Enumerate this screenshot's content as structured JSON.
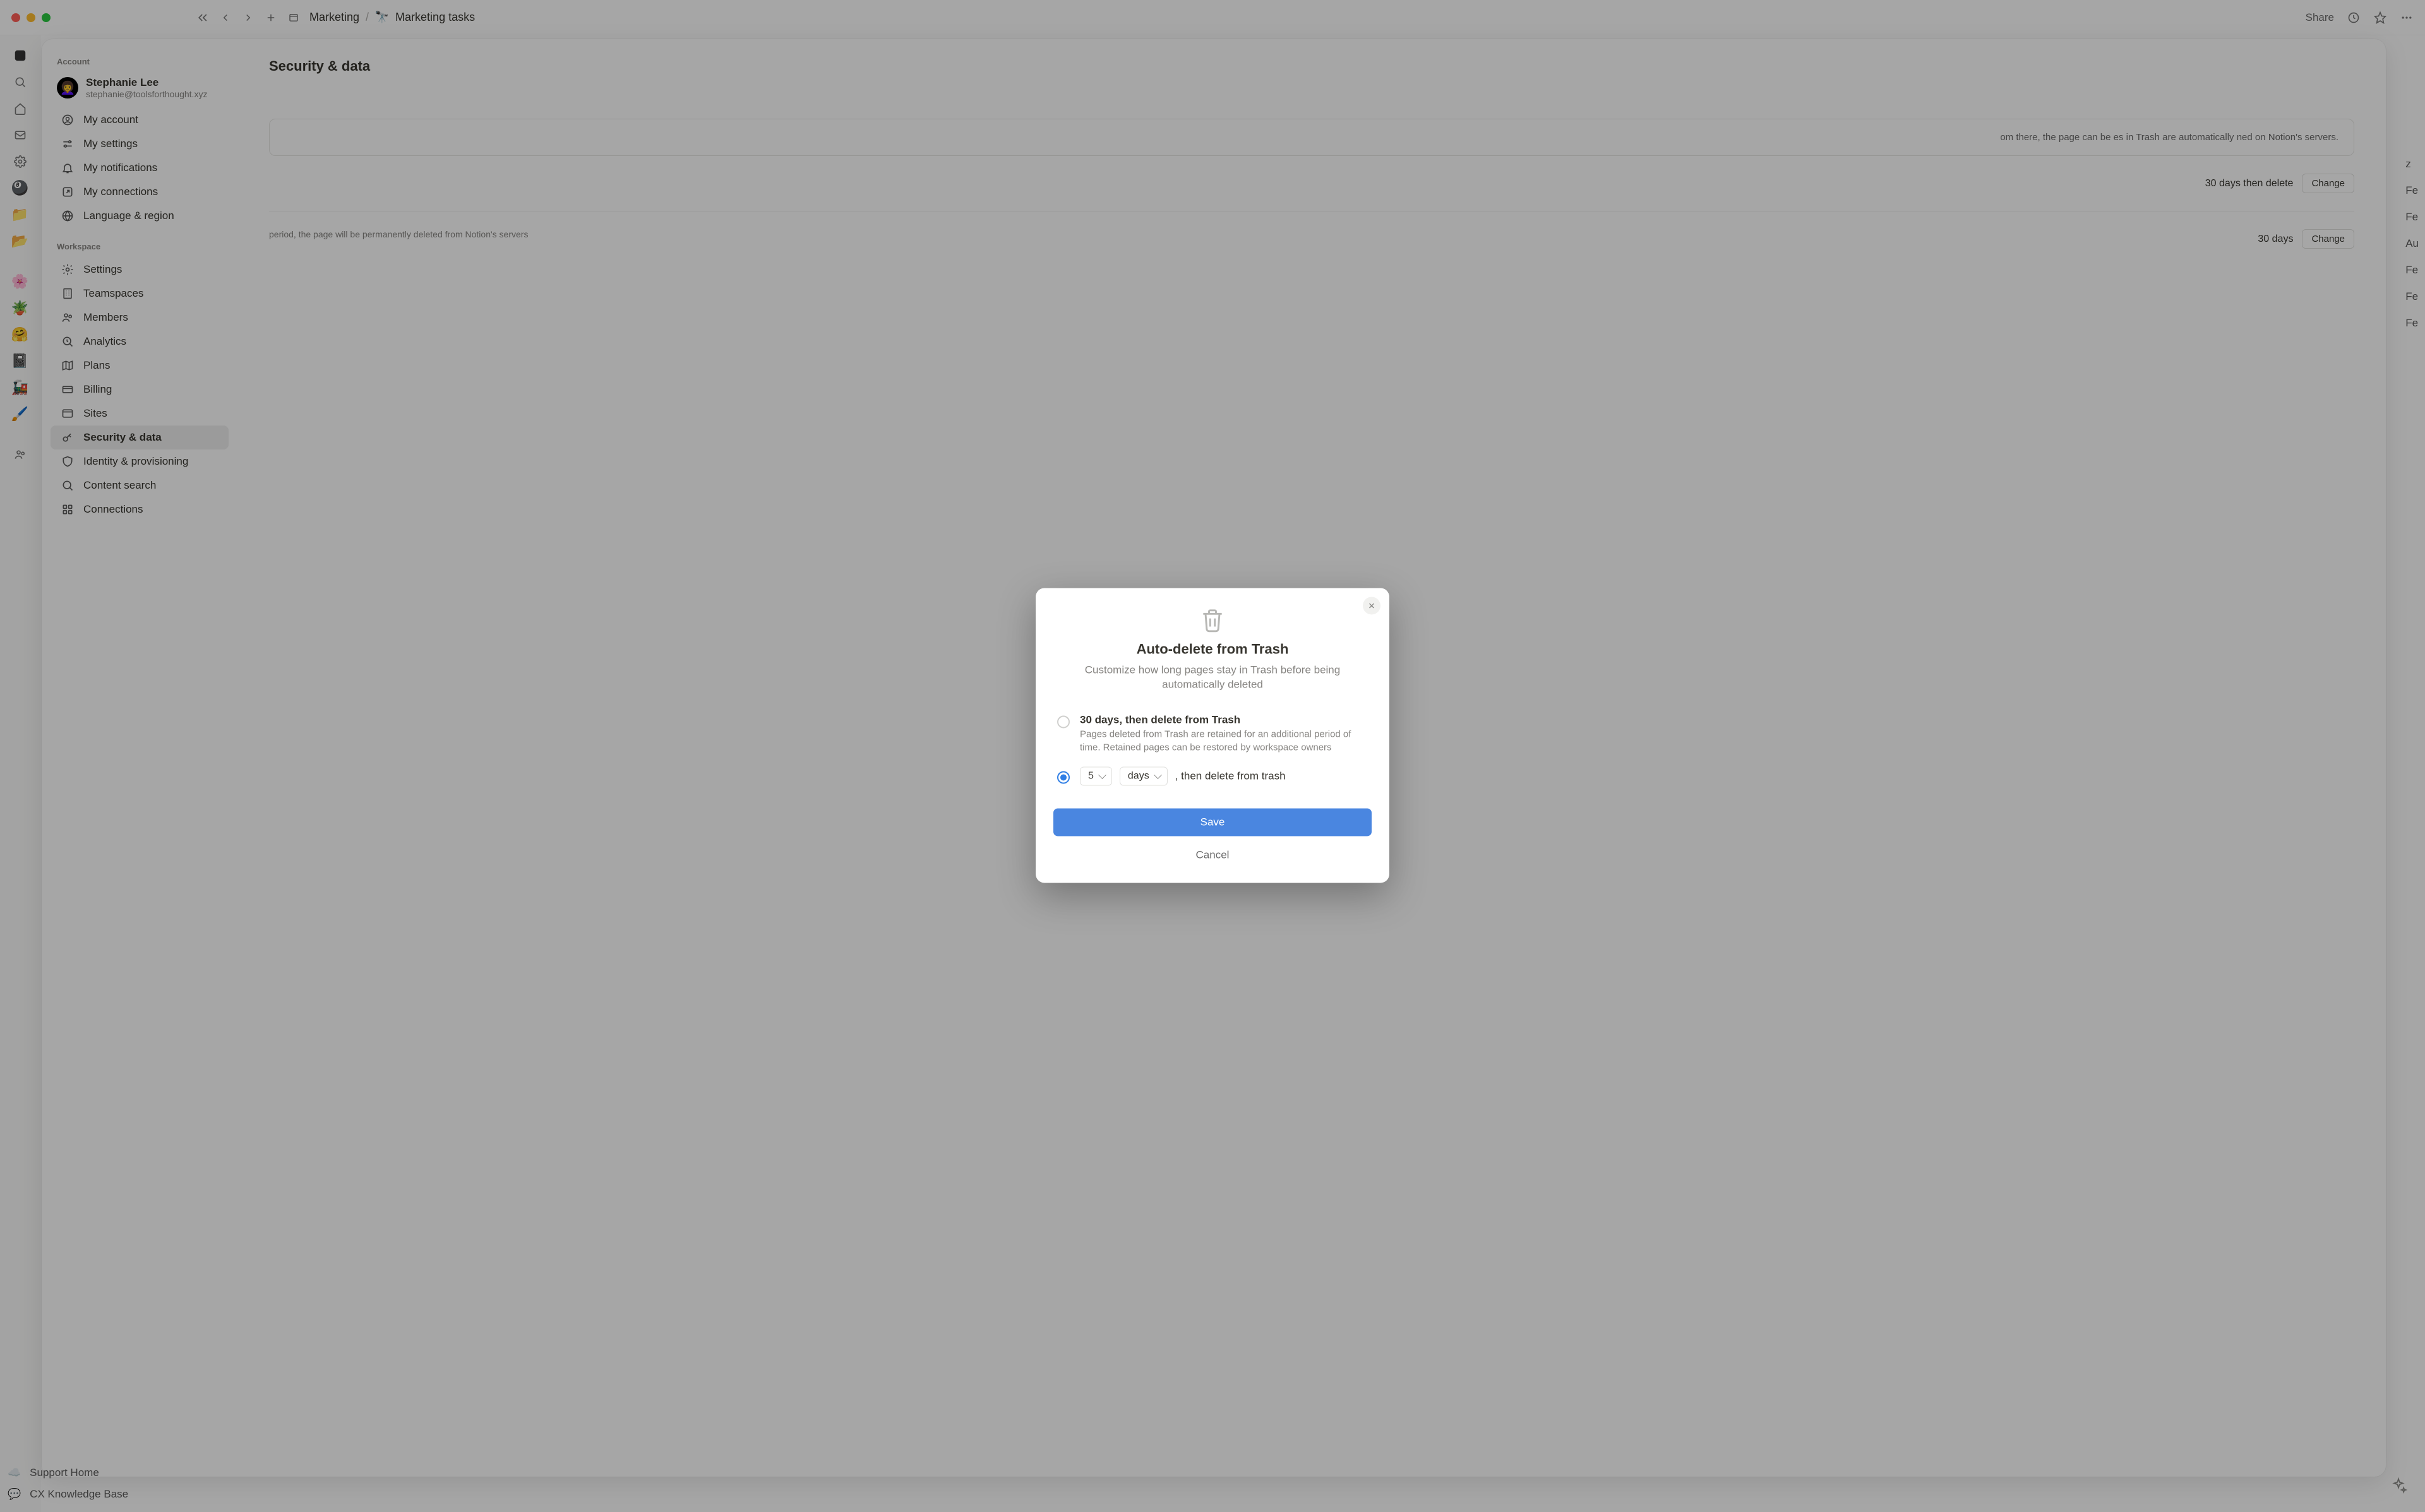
{
  "titlebar": {
    "breadcrumb_parent": "Marketing",
    "breadcrumb_page": "Marketing tasks",
    "share": "Share"
  },
  "rail_bottom": {
    "support": "Support Home",
    "kb": "CX Knowledge Base"
  },
  "right_ghost": [
    "z",
    "Fe",
    "Fe",
    "Au",
    "Fe",
    "Fe",
    "Fe"
  ],
  "settings": {
    "account_section": "Account",
    "user_name": "Stephanie Lee",
    "user_email": "stephanie@toolsforthought.xyz",
    "account_items": [
      "My account",
      "My settings",
      "My notifications",
      "My connections",
      "Language & region"
    ],
    "workspace_section": "Workspace",
    "workspace_items": [
      "Settings",
      "Teamspaces",
      "Members",
      "Analytics",
      "Plans",
      "Billing",
      "Sites",
      "Security & data",
      "Identity & provisioning",
      "Content search",
      "Connections"
    ],
    "active_item": "Security & data",
    "page_title": "Security & data",
    "card_text": "om there, the page can be es in Trash are automatically ned on Notion's servers.",
    "row1_value": "30 days then delete",
    "row1_btn": "Change",
    "row2_desc": "period, the page will be permanently deleted from Notion's servers",
    "row2_value": "30 days",
    "row2_btn": "Change"
  },
  "dialog": {
    "title": "Auto-delete from Trash",
    "subtitle": "Customize how long pages stay in Trash before being automatically deleted",
    "option1_title": "30 days, then delete from Trash",
    "option1_desc": "Pages deleted from Trash are retained for an additional period of time. Retained pages can be restored by workspace owners",
    "custom_number": "5",
    "custom_unit": "days",
    "custom_suffix": ", then delete from trash",
    "save": "Save",
    "cancel": "Cancel"
  }
}
